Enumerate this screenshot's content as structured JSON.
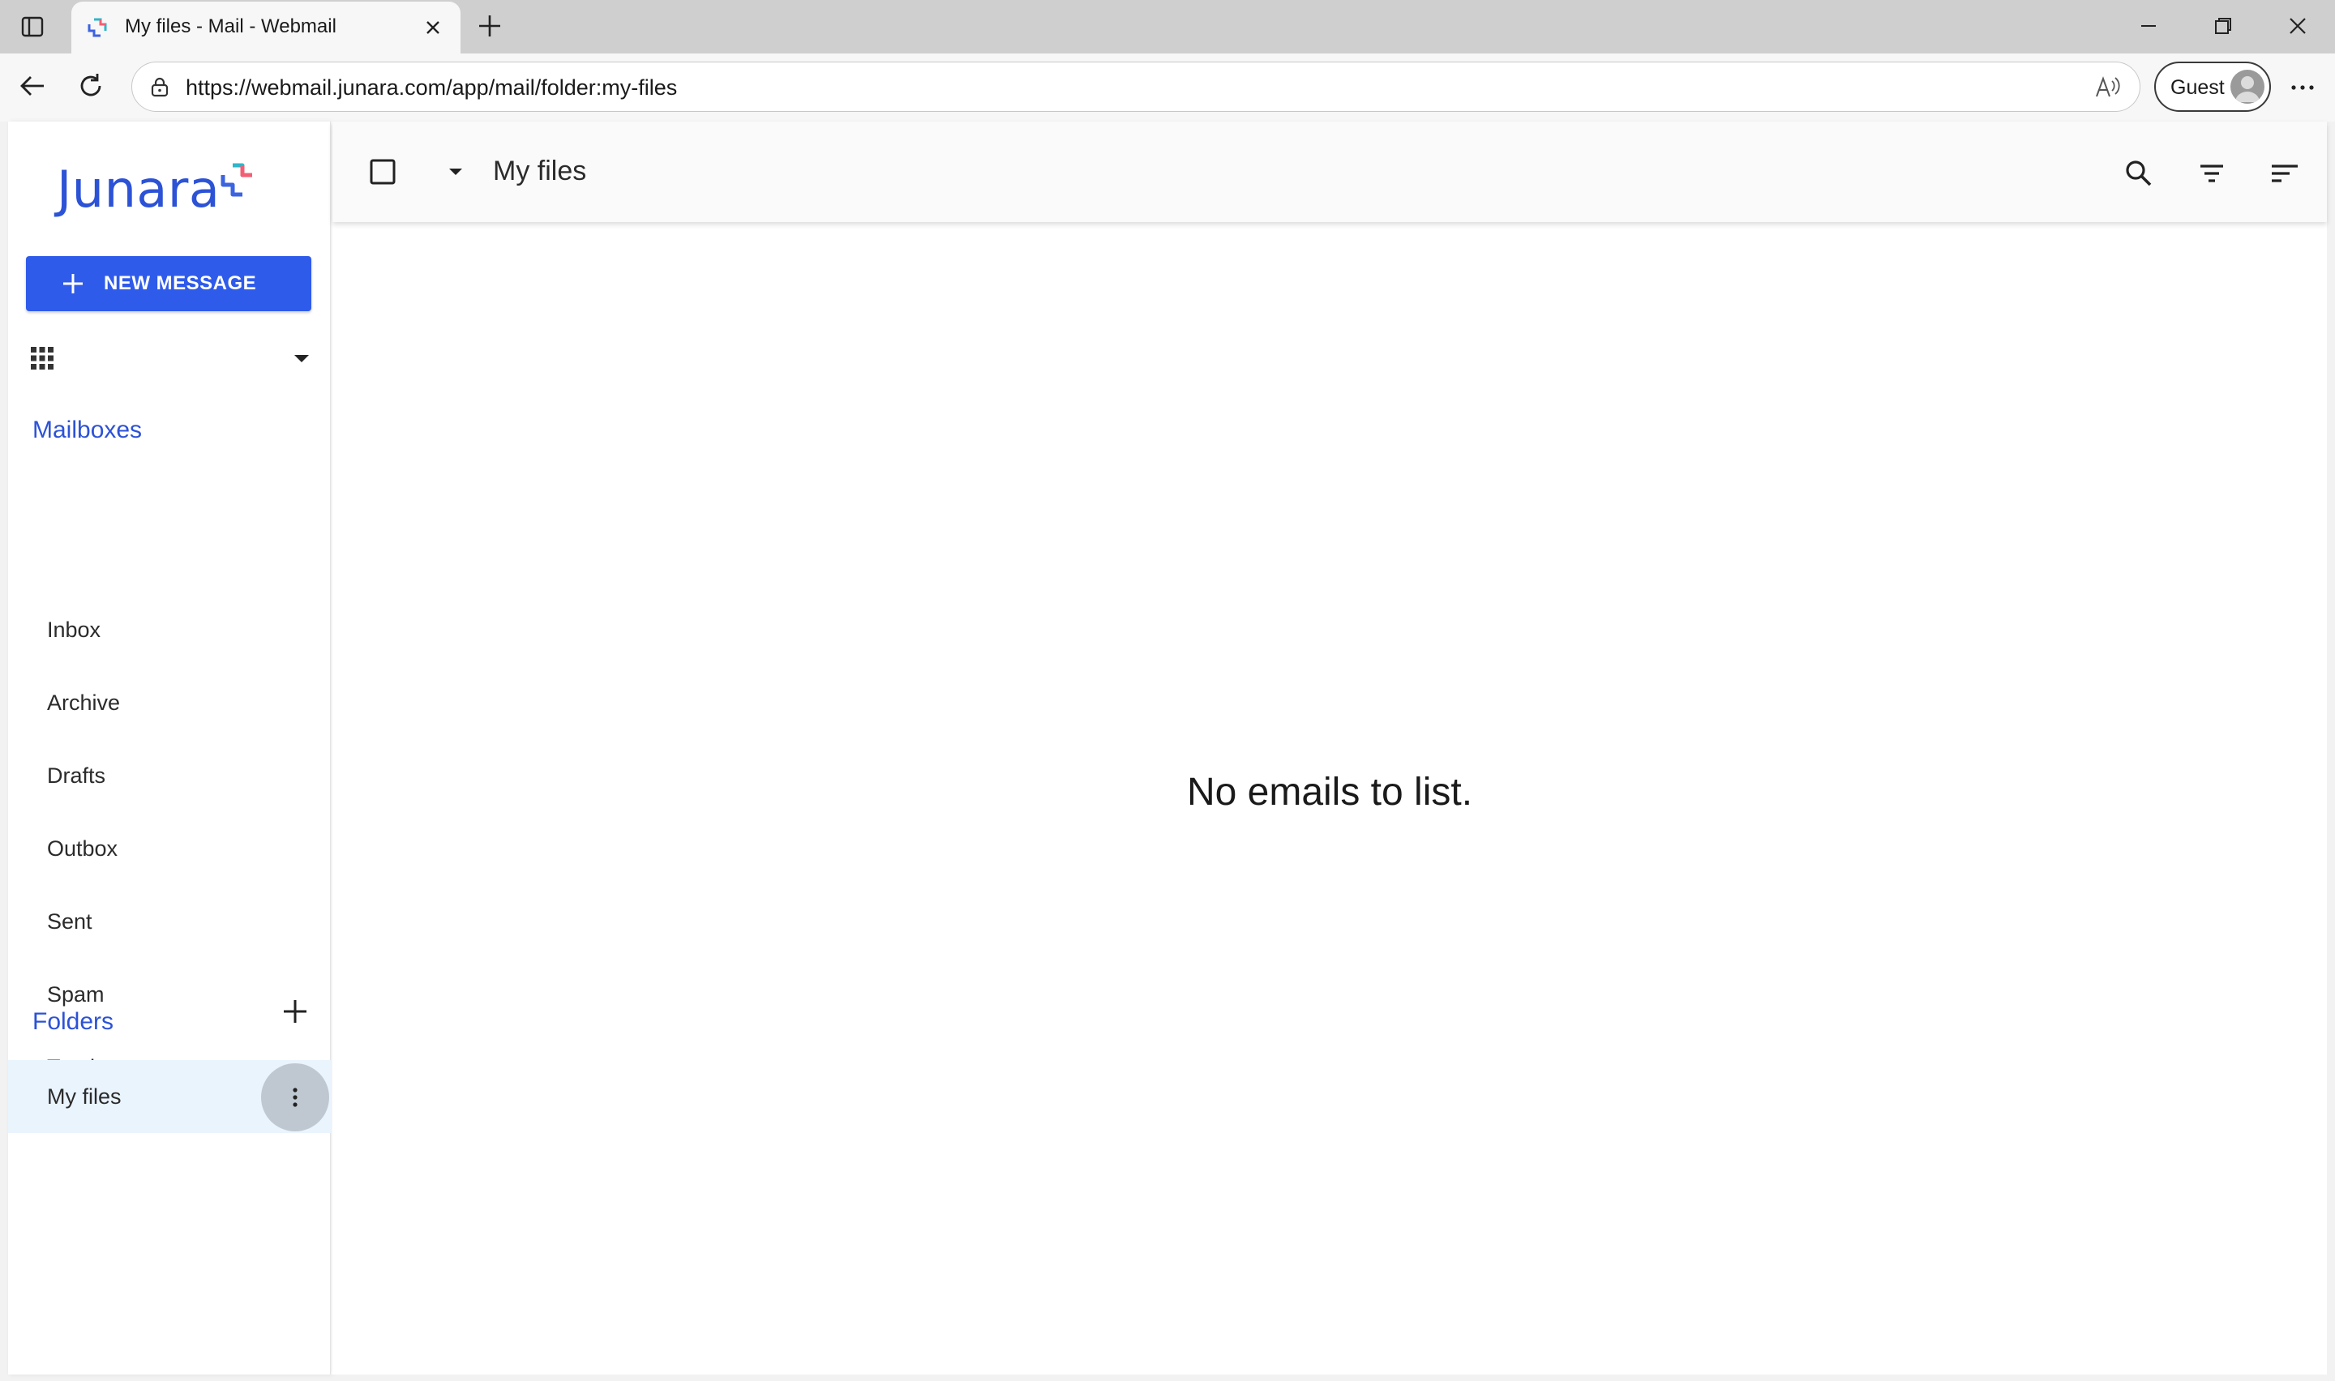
{
  "browser": {
    "tab_title": "My files - Mail - Webmail",
    "url": "https://webmail.junara.com/app/mail/folder:my-files",
    "profile_label": "Guest"
  },
  "sidebar": {
    "logo_text": "Junara",
    "new_message_label": "NEW MESSAGE",
    "mailboxes_title": "Mailboxes",
    "mailboxes": [
      {
        "label": "Inbox"
      },
      {
        "label": "Archive"
      },
      {
        "label": "Drafts"
      },
      {
        "label": "Outbox"
      },
      {
        "label": "Sent"
      },
      {
        "label": "Spam"
      },
      {
        "label": "Trash"
      }
    ],
    "folders_title": "Folders",
    "folders": [
      {
        "label": "My files",
        "selected": true
      }
    ]
  },
  "main": {
    "folder_title": "My files",
    "empty_message": "No emails to list."
  },
  "icons": {
    "search": "search-icon",
    "filter": "filter-icon",
    "sort": "sort-icon",
    "apps": "apps-grid-icon",
    "kebab": "more-vertical-icon"
  },
  "colors": {
    "accent": "#2f5bea",
    "brand_text": "#2c52d6",
    "selected_folder_bg": "#eaf4fd"
  }
}
